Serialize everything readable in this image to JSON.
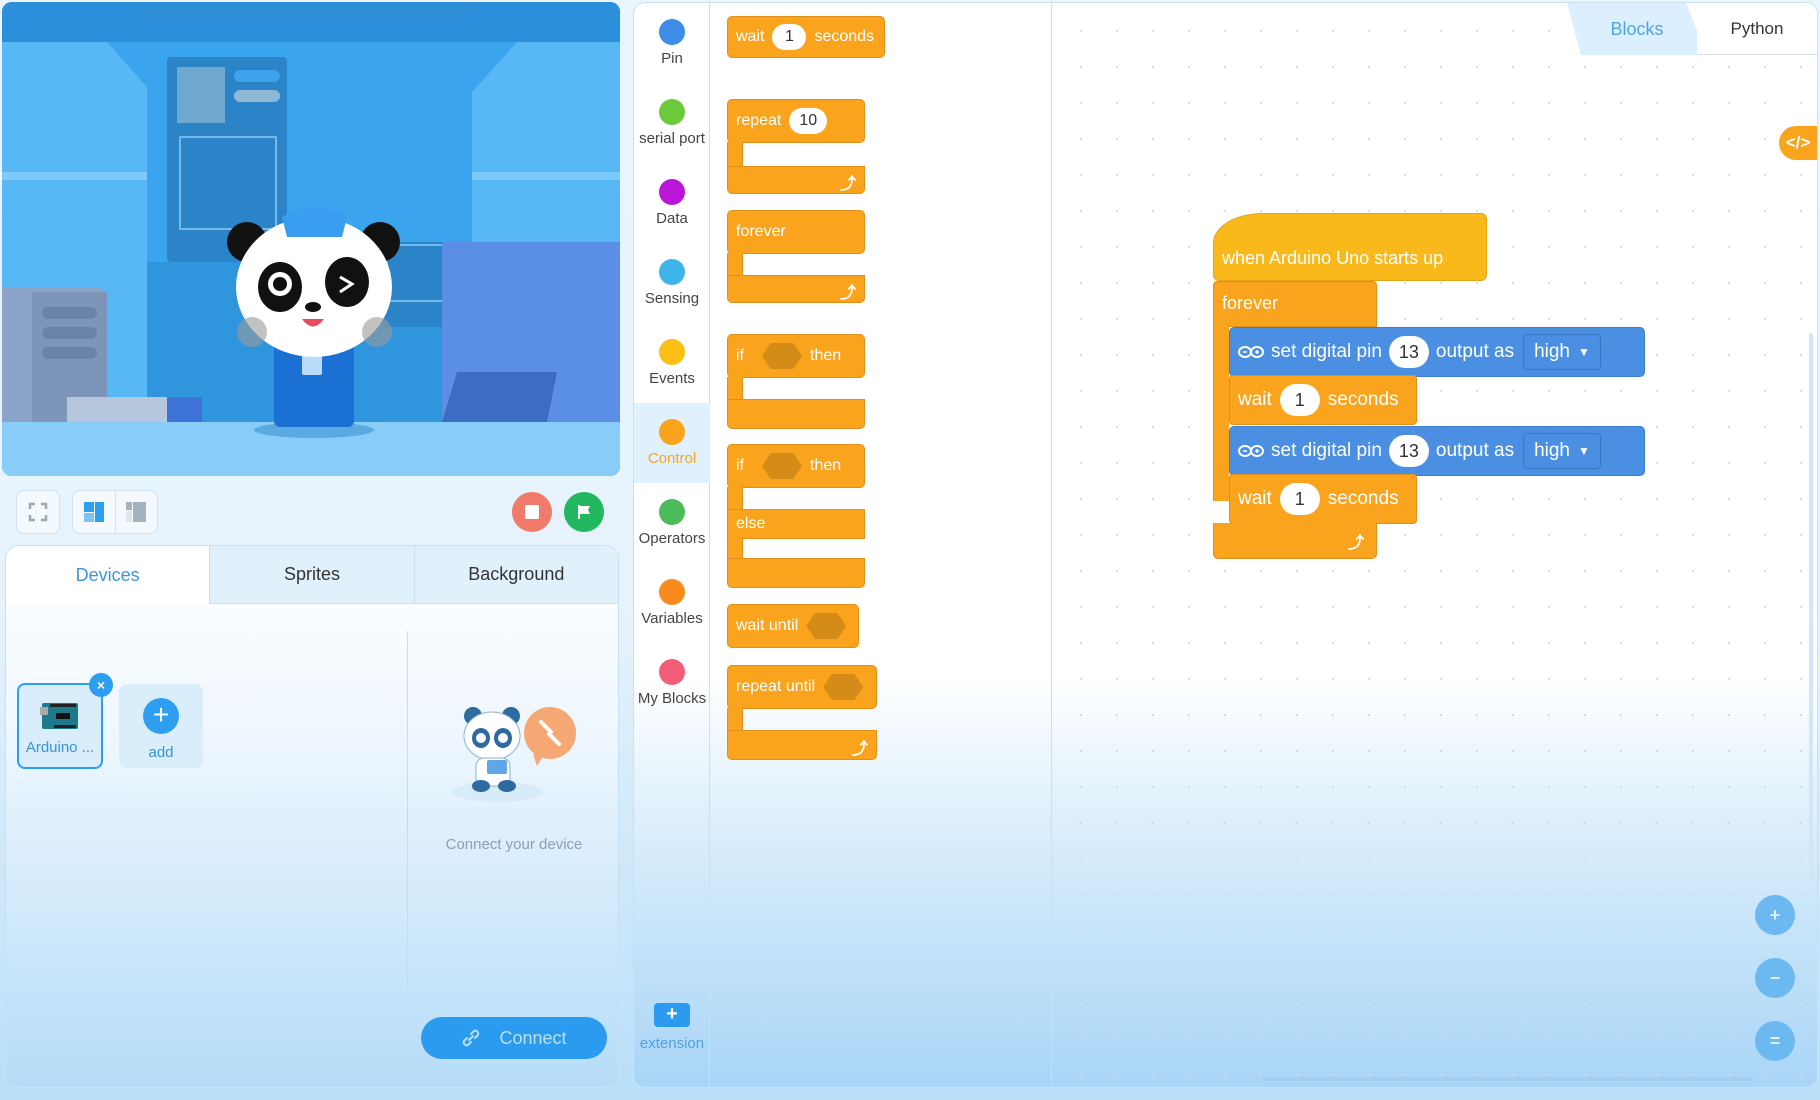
{
  "stage": {
    "controls": {
      "fullscreen_icon": "fullscreen-icon",
      "layout_large_icon": "layout-large-stage-icon",
      "layout_small_icon": "layout-small-stage-icon",
      "stop_icon": "stop-icon",
      "go_icon": "flag-icon"
    }
  },
  "device_panel": {
    "tabs": [
      {
        "label": "Devices",
        "active": true
      },
      {
        "label": "Sprites",
        "active": false
      },
      {
        "label": "Background",
        "active": false
      }
    ],
    "devices": [
      {
        "name": "Arduino ...",
        "selected": true
      }
    ],
    "add_label": "add",
    "remove_label": "×",
    "connect_hint": "Connect your device",
    "connect_button": "Connect"
  },
  "categories": [
    {
      "label": "Pin",
      "color": "#3d8de6"
    },
    {
      "label": "serial port",
      "color": "#6cc93a"
    },
    {
      "label": "Data",
      "color": "#bb15d9"
    },
    {
      "label": "Sensing",
      "color": "#3fb4ea"
    },
    {
      "label": "Events",
      "color": "#fbbf16"
    },
    {
      "label": "Control",
      "color": "#f9a41c",
      "active": true
    },
    {
      "label": "Operators",
      "color": "#4cbb5a"
    },
    {
      "label": "Variables",
      "color": "#f98a1c"
    },
    {
      "label": "My Blocks",
      "color": "#f35d78"
    }
  ],
  "extension_label": "extension",
  "palette": {
    "wait": {
      "label": "wait",
      "value": "1",
      "suffix": "seconds"
    },
    "repeat": {
      "label": "repeat",
      "value": "10"
    },
    "forever": {
      "label": "forever"
    },
    "if_then": {
      "if": "if",
      "then": "then"
    },
    "if_else": {
      "if": "if",
      "then": "then",
      "else": "else"
    },
    "wait_until": {
      "label": "wait until"
    },
    "repeat_until": {
      "label": "repeat until"
    }
  },
  "code_tabs": {
    "blocks": "Blocks",
    "python": "Python",
    "toggle": "</>"
  },
  "script": {
    "hat": "when Arduino Uno starts up",
    "forever": "forever",
    "steps": [
      {
        "type": "pin",
        "prefix": "set digital pin",
        "pin": "13",
        "middle": "output as",
        "level": "high"
      },
      {
        "type": "wait",
        "label": "wait",
        "value": "1",
        "suffix": "seconds"
      },
      {
        "type": "pin",
        "prefix": "set digital pin",
        "pin": "13",
        "middle": "output as",
        "level": "high"
      },
      {
        "type": "wait",
        "label": "wait",
        "value": "1",
        "suffix": "seconds"
      }
    ]
  },
  "zoom_controls": {
    "zoom_in": "+",
    "zoom_out": "−",
    "reset": "="
  },
  "colors": {
    "control": "#f9a41c",
    "pin": "#4a8fe2",
    "accent": "#2e9ff0"
  }
}
